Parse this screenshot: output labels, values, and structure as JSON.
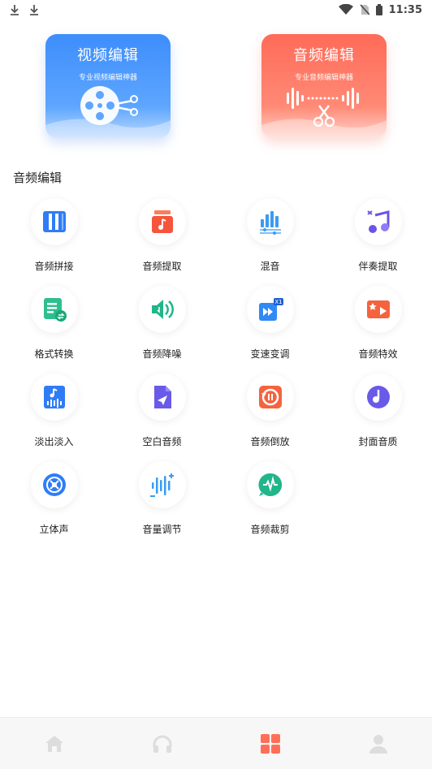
{
  "status_bar": {
    "time": "11:35"
  },
  "banners": {
    "video": {
      "title": "视频编辑",
      "subtitle": "专业视频编辑神器",
      "color": "#3d8dfb"
    },
    "audio": {
      "title": "音频编辑",
      "subtitle": "专业音频编辑神器",
      "color": "#ff6b58"
    }
  },
  "section": {
    "title": "音频编辑"
  },
  "tools": [
    {
      "label": "音频拼接",
      "icon": "audio-splice-icon"
    },
    {
      "label": "音频提取",
      "icon": "audio-extract-icon"
    },
    {
      "label": "混音",
      "icon": "mix-icon"
    },
    {
      "label": "伴奏提取",
      "icon": "accompaniment-extract-icon"
    },
    {
      "label": "格式转换",
      "icon": "format-convert-icon"
    },
    {
      "label": "音频降噪",
      "icon": "noise-reduction-icon"
    },
    {
      "label": "变速变调",
      "icon": "speed-pitch-icon"
    },
    {
      "label": "音频特效",
      "icon": "audio-effects-icon"
    },
    {
      "label": "淡出淡入",
      "icon": "fade-icon"
    },
    {
      "label": "空白音频",
      "icon": "blank-audio-icon"
    },
    {
      "label": "音频倒放",
      "icon": "reverse-icon"
    },
    {
      "label": "封面音质",
      "icon": "cover-quality-icon"
    },
    {
      "label": "立体声",
      "icon": "stereo-icon"
    },
    {
      "label": "音量调节",
      "icon": "volume-adjust-icon"
    },
    {
      "label": "音频裁剪",
      "icon": "audio-trim-icon"
    }
  ],
  "tabbar": {
    "tabs": [
      {
        "icon": "home-icon",
        "active": false
      },
      {
        "icon": "headphones-icon",
        "active": false
      },
      {
        "icon": "tools-grid-icon",
        "active": true
      },
      {
        "icon": "profile-icon",
        "active": false
      }
    ],
    "active_color": "#ff6f57",
    "inactive_color": "#dddddd"
  }
}
